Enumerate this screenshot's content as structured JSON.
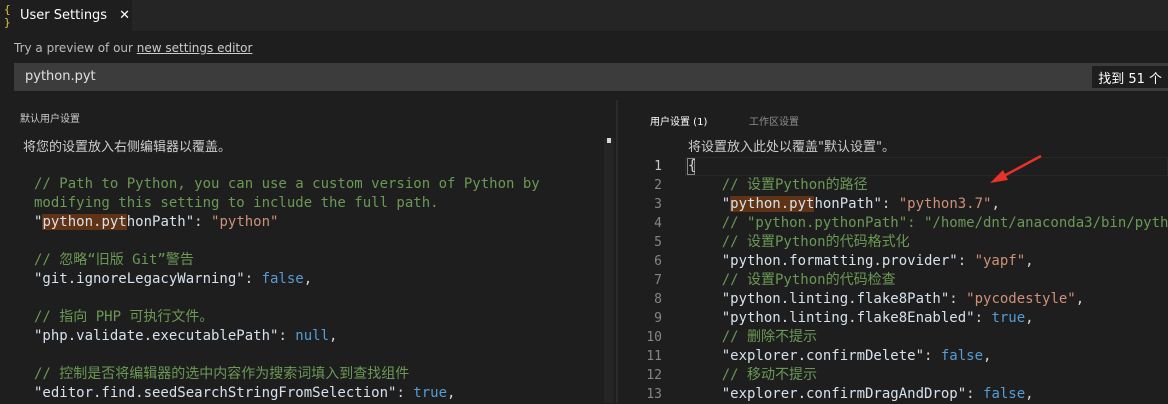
{
  "tab": {
    "icon_glyph": "{ }",
    "icon_name": "json-file-icon",
    "title": "User Settings",
    "close_glyph": "✕"
  },
  "preview": {
    "prefix": "Try a preview of our ",
    "link": "new settings editor"
  },
  "search": {
    "value": "python.pyt",
    "count": "找到 51 个"
  },
  "left": {
    "header": "默认用户设置",
    "description": "将您的设置放入右侧编辑器以覆盖。",
    "lines": [
      [
        {
          "t": "// Path to Python, you can use a custom version of Python by",
          "c": "c-comment"
        }
      ],
      [
        {
          "t": "modifying this setting to include the full path.",
          "c": "c-comment"
        }
      ],
      [
        {
          "t": "\"",
          "c": "c-key"
        },
        {
          "t": "python.pyt",
          "c": "c-key hl"
        },
        {
          "t": "honPath\"",
          "c": "c-key"
        },
        {
          "t": ": ",
          "c": "c-punct"
        },
        {
          "t": "\"python\"",
          "c": "c-str"
        }
      ],
      [],
      [
        {
          "t": "// 忽略“旧版 Git”警告",
          "c": "c-comment"
        }
      ],
      [
        {
          "t": "\"git.ignoreLegacyWarning\"",
          "c": "c-key"
        },
        {
          "t": ": ",
          "c": "c-punct"
        },
        {
          "t": "false",
          "c": "c-bool"
        },
        {
          "t": ",",
          "c": "c-punct"
        }
      ],
      [],
      [
        {
          "t": "// 指向 PHP 可执行文件。",
          "c": "c-comment"
        }
      ],
      [
        {
          "t": "\"php.validate.executablePath\"",
          "c": "c-key"
        },
        {
          "t": ": ",
          "c": "c-punct"
        },
        {
          "t": "null",
          "c": "c-bool"
        },
        {
          "t": ",",
          "c": "c-punct"
        }
      ],
      [],
      [
        {
          "t": "// 控制是否将编辑器的选中内容作为搜索词填入到查找组件",
          "c": "c-comment"
        }
      ],
      [
        {
          "t": "\"editor.find.seedSearchStringFromSelection\"",
          "c": "c-key"
        },
        {
          "t": ": ",
          "c": "c-punct"
        },
        {
          "t": "true",
          "c": "c-bool"
        },
        {
          "t": ",",
          "c": "c-punct"
        }
      ]
    ]
  },
  "right": {
    "tabs": [
      {
        "label": "用户设置 (1)"
      },
      {
        "label": "工作区设置"
      }
    ],
    "description": "将设置放入此处以覆盖\"默认设置\"。",
    "line_numbers": [
      "1",
      "2",
      "3",
      "4",
      "5",
      "6",
      "7",
      "8",
      "9",
      "10",
      "11",
      "12",
      "13"
    ],
    "lines": [
      [
        {
          "t": "{",
          "c": "c-punct"
        }
      ],
      [
        {
          "t": "    // 设置Python的路径",
          "c": "c-comment"
        }
      ],
      [
        {
          "t": "    \"",
          "c": "c-key"
        },
        {
          "t": "python.pyt",
          "c": "c-key hl"
        },
        {
          "t": "honPath\"",
          "c": "c-key"
        },
        {
          "t": ": ",
          "c": "c-punct"
        },
        {
          "t": "\"python3.7\"",
          "c": "c-str"
        },
        {
          "t": ",",
          "c": "c-punct"
        }
      ],
      [
        {
          "t": "    // \"python.pythonPath\": \"/home/dnt/anaconda3/bin/python\",",
          "c": "c-comment"
        }
      ],
      [
        {
          "t": "    // 设置Python的代码格式化",
          "c": "c-comment"
        }
      ],
      [
        {
          "t": "    \"python.formatting.provider\"",
          "c": "c-key"
        },
        {
          "t": ": ",
          "c": "c-punct"
        },
        {
          "t": "\"yapf\"",
          "c": "c-str"
        },
        {
          "t": ",",
          "c": "c-punct"
        }
      ],
      [
        {
          "t": "    // 设置Python的代码检查",
          "c": "c-comment"
        }
      ],
      [
        {
          "t": "    \"python.linting.flake8Path\"",
          "c": "c-key"
        },
        {
          "t": ": ",
          "c": "c-punct"
        },
        {
          "t": "\"pycodestyle\"",
          "c": "c-str"
        },
        {
          "t": ",",
          "c": "c-punct"
        }
      ],
      [
        {
          "t": "    \"python.linting.flake8Enabled\"",
          "c": "c-key"
        },
        {
          "t": ": ",
          "c": "c-punct"
        },
        {
          "t": "true",
          "c": "c-bool"
        },
        {
          "t": ",",
          "c": "c-punct"
        }
      ],
      [
        {
          "t": "    // 删除不提示",
          "c": "c-comment"
        }
      ],
      [
        {
          "t": "    \"explorer.confirmDelete\"",
          "c": "c-key"
        },
        {
          "t": ": ",
          "c": "c-punct"
        },
        {
          "t": "false",
          "c": "c-bool"
        },
        {
          "t": ",",
          "c": "c-punct"
        }
      ],
      [
        {
          "t": "    // 移动不提示",
          "c": "c-comment"
        }
      ],
      [
        {
          "t": "    \"explorer.confirmDragAndDrop\"",
          "c": "c-key"
        },
        {
          "t": ": ",
          "c": "c-punct"
        },
        {
          "t": "false",
          "c": "c-bool"
        },
        {
          "t": ",",
          "c": "c-punct"
        }
      ]
    ]
  },
  "colors": {
    "accent_arrow": "#e8312a",
    "comment": "#6a9955",
    "string": "#ce9178",
    "keyword": "#569cd6",
    "match_highlight": "#613315"
  }
}
